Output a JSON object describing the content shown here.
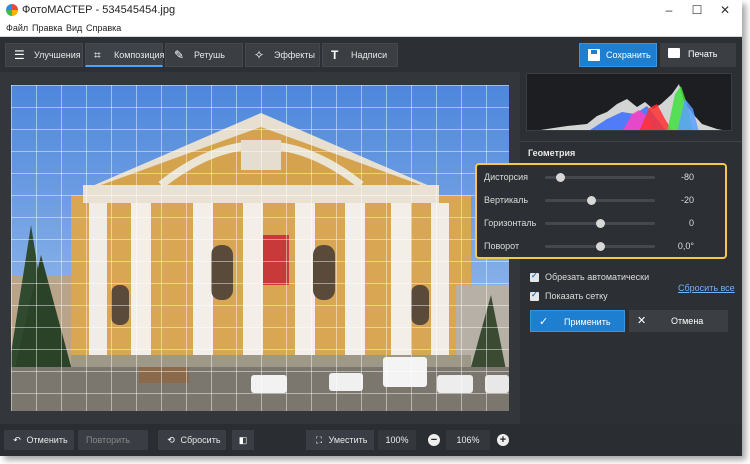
{
  "window": {
    "title": "ФотоМАСТЕР - 534545454.jpg"
  },
  "menu": [
    "Файл",
    "Правка",
    "Вид",
    "Справка"
  ],
  "tabs": [
    {
      "label": "Улучшения",
      "icon": "sliders-icon"
    },
    {
      "label": "Композиция",
      "icon": "crop-icon",
      "active": true
    },
    {
      "label": "Ретушь",
      "icon": "brush-icon"
    },
    {
      "label": "Эффекты",
      "icon": "magic-wand-icon"
    },
    {
      "label": "Надписи",
      "icon": "text-icon"
    }
  ],
  "actions": {
    "save_label": "Сохранить",
    "print_label": "Печать"
  },
  "panel": {
    "section_title": "Геометрия",
    "sliders": [
      {
        "label": "Дисторсия",
        "value": "-80",
        "position": 0.14
      },
      {
        "label": "Вертикаль",
        "value": "-20",
        "position": 0.42
      },
      {
        "label": "Горизонталь",
        "value": "0",
        "position": 0.5
      },
      {
        "label": "Поворот",
        "value": "0,0°",
        "position": 0.5
      }
    ],
    "checkboxes": [
      {
        "label": "Обрезать автоматически",
        "checked": true
      },
      {
        "label": "Показать сетку",
        "checked": true
      }
    ],
    "reset_all": "Сбросить все",
    "apply_label": "Применить",
    "cancel_label": "Отмена"
  },
  "bottom": {
    "undo_label": "Отменить",
    "redo_label": "Повторить",
    "reset_label": "Сбросить",
    "fit_label": "Уместить",
    "zoom_100": "100%",
    "zoom_current": "106%"
  },
  "colors": {
    "accent": "#1e7fd0",
    "highlight": "#f4c94a",
    "background": "#2c2f33"
  }
}
